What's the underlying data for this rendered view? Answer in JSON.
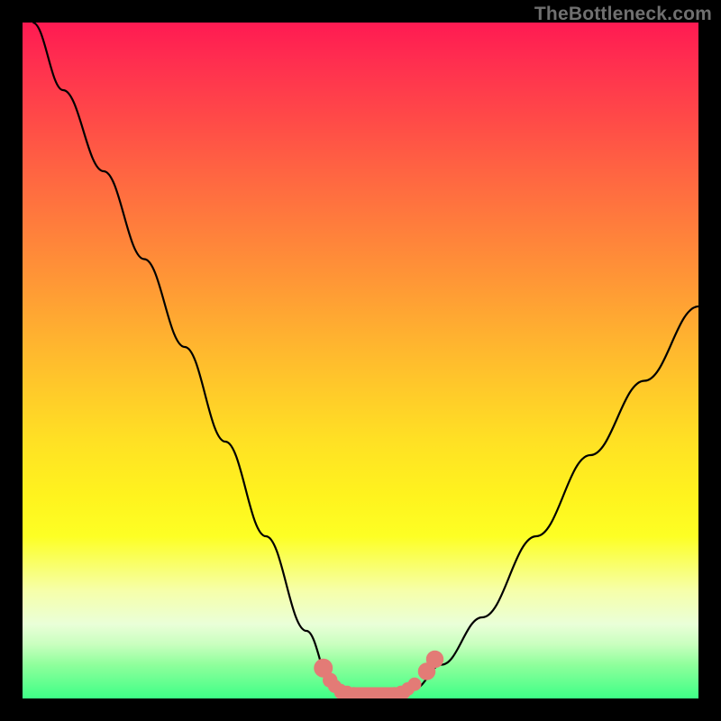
{
  "watermark": "TheBottleneck.com",
  "colors": {
    "gradient_top": "#ff1a52",
    "gradient_bottom": "#3eff86",
    "curve": "#000000",
    "marker": "#e37b76",
    "frame": "#000000"
  },
  "chart_data": {
    "type": "line",
    "title": "",
    "xlabel": "",
    "ylabel": "",
    "xlim": [
      0,
      100
    ],
    "ylim": [
      0,
      100
    ],
    "grid": false,
    "legend": false,
    "curve_points": [
      {
        "x": 1.5,
        "y": 100
      },
      {
        "x": 6,
        "y": 90
      },
      {
        "x": 12,
        "y": 78
      },
      {
        "x": 18,
        "y": 65
      },
      {
        "x": 24,
        "y": 52
      },
      {
        "x": 30,
        "y": 38
      },
      {
        "x": 36,
        "y": 24
      },
      {
        "x": 42,
        "y": 10
      },
      {
        "x": 46,
        "y": 1.5
      },
      {
        "x": 50,
        "y": 0.5
      },
      {
        "x": 54,
        "y": 0.5
      },
      {
        "x": 58,
        "y": 1.5
      },
      {
        "x": 62,
        "y": 5
      },
      {
        "x": 68,
        "y": 12
      },
      {
        "x": 76,
        "y": 24
      },
      {
        "x": 84,
        "y": 36
      },
      {
        "x": 92,
        "y": 47
      },
      {
        "x": 100,
        "y": 58
      }
    ],
    "markers": [
      {
        "x": 44.5,
        "y": 4.5,
        "r": 1.4
      },
      {
        "x": 45.5,
        "y": 2.7,
        "r": 1.1
      },
      {
        "x": 46.2,
        "y": 1.8,
        "r": 1.0
      },
      {
        "x": 47.0,
        "y": 1.2,
        "r": 1.0
      },
      {
        "x": 48.0,
        "y": 0.9,
        "r": 1.0
      },
      {
        "x": 49.0,
        "y": 0.7,
        "r": 1.0
      },
      {
        "x": 50.5,
        "y": 0.6,
        "r": 1.0
      },
      {
        "x": 52.0,
        "y": 0.6,
        "r": 1.0
      },
      {
        "x": 53.5,
        "y": 0.6,
        "r": 1.0
      },
      {
        "x": 55.0,
        "y": 0.7,
        "r": 1.0
      },
      {
        "x": 56.0,
        "y": 0.9,
        "r": 1.0
      },
      {
        "x": 57.0,
        "y": 1.4,
        "r": 1.0
      },
      {
        "x": 58.0,
        "y": 2.1,
        "r": 1.0
      },
      {
        "x": 59.8,
        "y": 4.0,
        "r": 1.3
      },
      {
        "x": 61.0,
        "y": 5.8,
        "r": 1.3
      }
    ],
    "flat_segment": {
      "x1": 47,
      "x2": 56.5,
      "y": 0.8
    }
  }
}
